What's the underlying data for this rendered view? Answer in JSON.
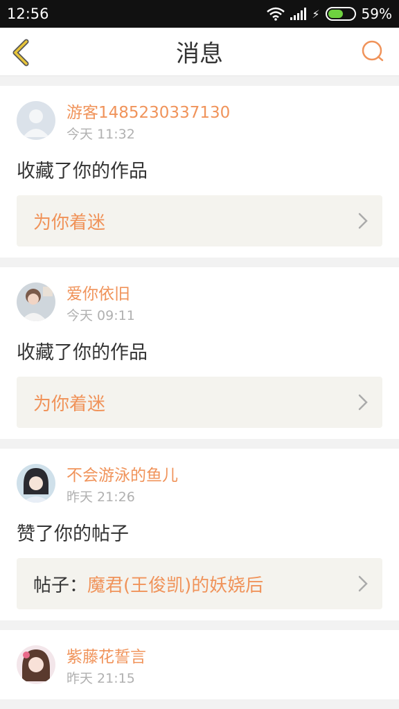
{
  "status_bar": {
    "time": "12:56",
    "battery": "59%",
    "battery_level": 0.59
  },
  "header": {
    "title": "消息"
  },
  "messages": [
    {
      "username": "游客1485230337130",
      "time": "今天 11:32",
      "action": "收藏了你的作品",
      "link": {
        "prefix": "",
        "text": "为你着迷"
      }
    },
    {
      "username": "爱你依旧",
      "time": "今天 09:11",
      "action": "收藏了你的作品",
      "link": {
        "prefix": "",
        "text": "为你着迷"
      }
    },
    {
      "username": "不会游泳的鱼儿",
      "time": "昨天 21:26",
      "action": "赞了你的帖子",
      "link": {
        "prefix": "帖子：",
        "text": "魔君(王俊凯)的妖娆后"
      }
    },
    {
      "username": "紫藤花誓言",
      "time": "昨天 21:15",
      "action": "",
      "link": null
    }
  ],
  "colors": {
    "accent": "#f0935a",
    "back_arrow": "#e8c53a",
    "link_bg": "#f4f3ee"
  },
  "icons": [
    "back-arrow-icon",
    "search-icon",
    "chevron-right-icon",
    "wifi-icon",
    "signal-icon",
    "battery-icon"
  ]
}
